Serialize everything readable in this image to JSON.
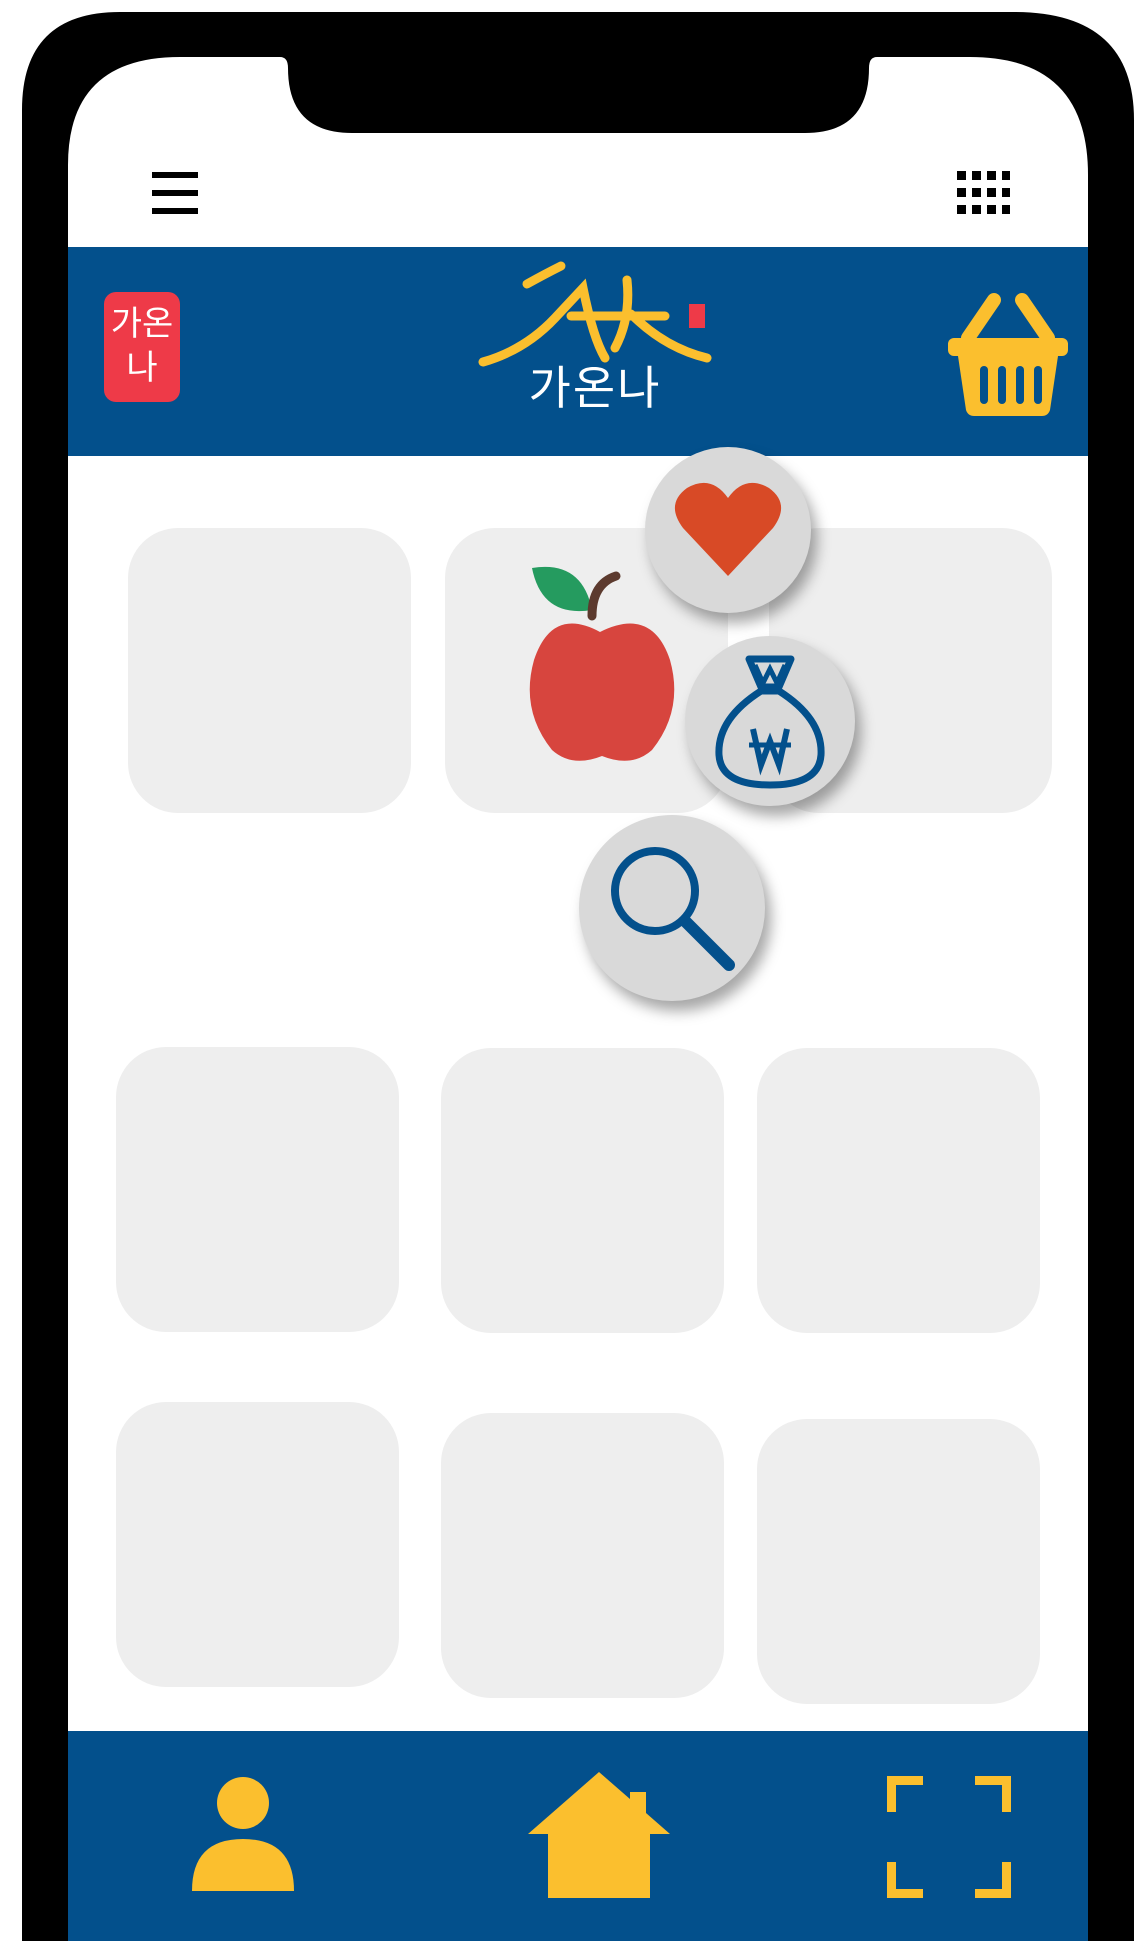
{
  "brand": {
    "name": "가온나",
    "badge_label": "가온나",
    "seal_label": "가온나"
  },
  "icons": {
    "menu": "hamburger-menu-icon",
    "apps": "grid-icon",
    "cart": "basket-icon",
    "favorite": "heart-icon",
    "price": "money-bag-won-icon",
    "search": "magnifier-icon",
    "profile": "user-icon",
    "home": "home-icon",
    "scan": "scan-frame-icon"
  },
  "product": {
    "item": "apple"
  },
  "colors": {
    "brand_blue": "#03508c",
    "accent_yellow": "#fbbf2e",
    "badge_red": "#ee3a48",
    "heart_red": "#d84a26",
    "tile_gray": "#eeeeee",
    "fab_gray": "#d9d9d9"
  }
}
